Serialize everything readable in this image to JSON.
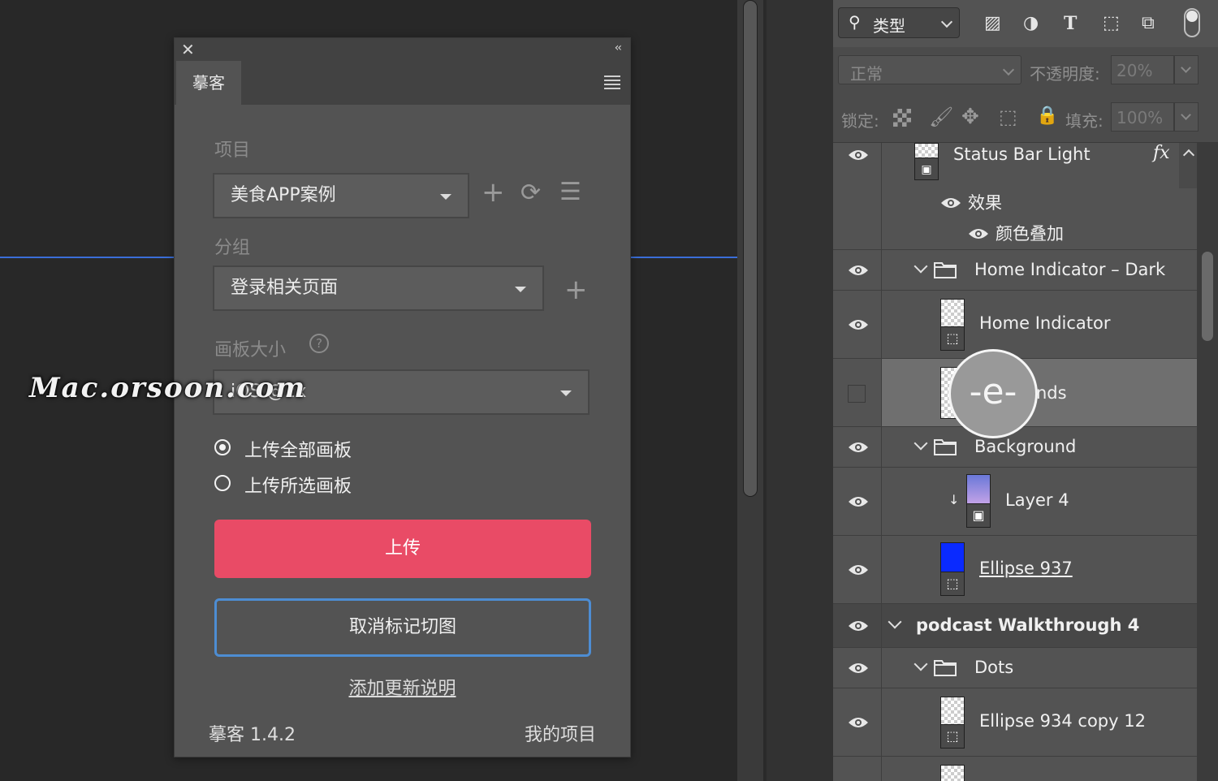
{
  "plugin": {
    "tab": "摹客",
    "project_label": "项目",
    "project_value": "美食APP案例",
    "group_label": "分组",
    "group_value": "登录相关页面",
    "artboard_size_label": "画板大小",
    "artboard_size_value": "iOS @2x",
    "radio_all": "上传全部画板",
    "radio_selected": "上传所选画板",
    "radio_checked": "all",
    "upload_button": "上传",
    "unmark_button": "取消标记切图",
    "release_notes_link": "添加更新说明",
    "version": "摹客 1.4.2",
    "my_projects": "我的项目",
    "accent_color": "#e94b66",
    "outline_color": "#4d8dd3"
  },
  "layers_toolbar": {
    "filter_type": "类型",
    "blend_mode": "正常",
    "opacity_label": "不透明度:",
    "opacity_value": "20%",
    "lock_label": "锁定:",
    "fill_label": "填充:",
    "fill_value": "100%"
  },
  "layers": {
    "status_bar_light": "Status Bar Light",
    "fx": "fx",
    "effects": "效果",
    "color_overlay": "颜色叠加",
    "home_indicator_dark": "Home Indicator – Dark",
    "home_indicator": "Home Indicator",
    "bounds_partial": "nds",
    "background": "Background",
    "layer4": "Layer 4",
    "ellipse937": "Ellipse 937",
    "podcast_group": "podcast Walkthrough 4",
    "dots": "Dots",
    "ellipse934": "Ellipse 934 copy 12"
  },
  "overlay": {
    "watermark": "Mac.orsoon.com",
    "zoom_bubble": "-e-"
  }
}
